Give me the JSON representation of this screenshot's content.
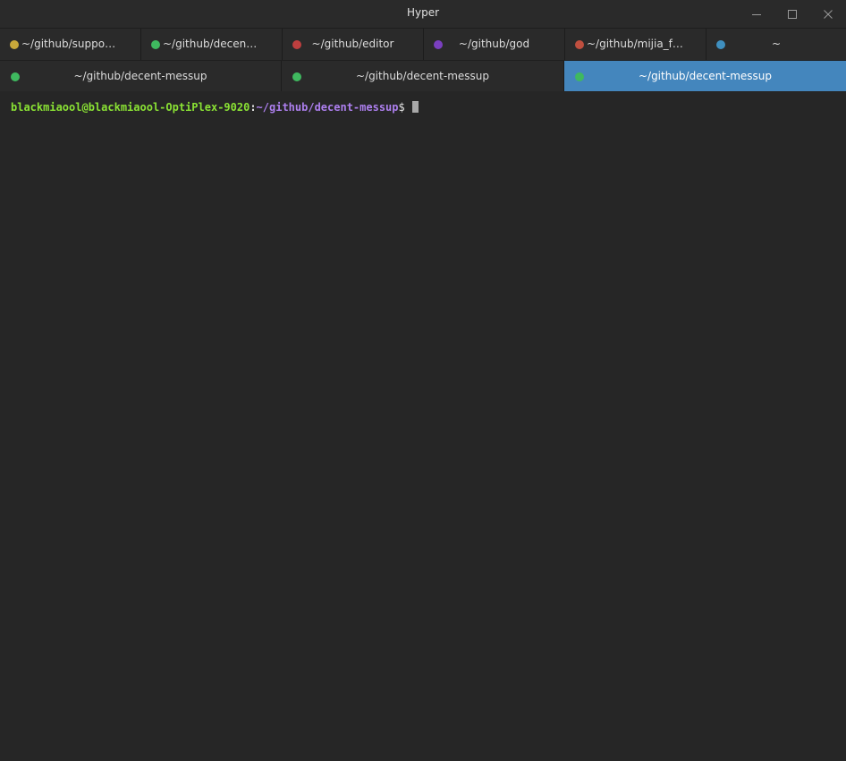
{
  "window": {
    "title": "Hyper",
    "controls": {
      "minimize": "minimize-icon",
      "maximize": "maximize-icon",
      "close": "close-icon"
    }
  },
  "tabs_row1": [
    {
      "label": "~/github/support…",
      "dot_color": "#c9a83a"
    },
    {
      "label": "~/github/decent-…",
      "dot_color": "#3fb95f"
    },
    {
      "label": "~/github/editor",
      "dot_color": "#bf3f3f"
    },
    {
      "label": "~/github/god",
      "dot_color": "#7a3fbf"
    },
    {
      "label": "~/github/mijia_fe…",
      "dot_color": "#bf4f3f"
    },
    {
      "label": "~",
      "dot_color": "#3f8fbf"
    }
  ],
  "tabs_row2": [
    {
      "label": "~/github/decent-messup",
      "dot_color": "#3fb95f",
      "active": false
    },
    {
      "label": "~/github/decent-messup",
      "dot_color": "#3fb95f",
      "active": false
    },
    {
      "label": "~/github/decent-messup",
      "dot_color": "#3fb95f",
      "active": true
    }
  ],
  "terminal": {
    "user_host": "blackmiaool@blackmiaool-OptiPlex-9020",
    "separator": ":",
    "path": "~/github/decent-messup",
    "prompt_symbol": "$ "
  },
  "colors": {
    "background": "#262626",
    "active_tab": "#4486bd",
    "user_host": "#8ae234",
    "path": "#ad7fee"
  }
}
